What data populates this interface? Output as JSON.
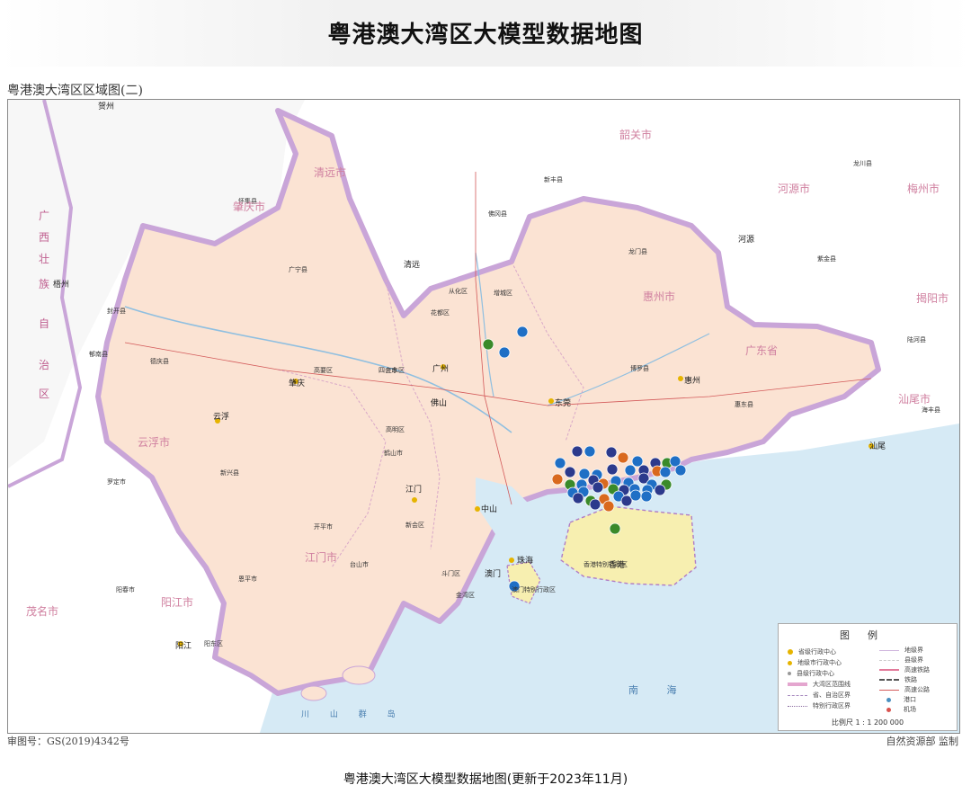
{
  "header": {
    "title": "粤港澳大湾区大模型数据地图"
  },
  "map": {
    "name": "粤港澳大湾区区域图(二)",
    "review_number": "审图号：GS(2019)4342号",
    "supervisor": "自然资源部 监制",
    "caption": "粤港澳大湾区大模型数据地图(更新于2023年11月)"
  },
  "legend": {
    "title": "图例",
    "items_left": [
      "省级行政中心",
      "地级市行政中心",
      "县级行政中心",
      "大湾区范围线",
      "省、自治区界",
      "特别行政区界"
    ],
    "items_right": [
      "地级界",
      "县级界",
      "高速铁路",
      "铁路",
      "高速公路",
      "港口",
      "机场"
    ],
    "scale": "比例尺 1 : 1 200 000"
  },
  "colors": {
    "blue": "#1f6fc5",
    "navy": "#2c3a8c",
    "green": "#3a8a2a",
    "orange": "#d9691e",
    "land": "#fbe3d3",
    "sea": "#d6eaf5",
    "outside": "#ffffff",
    "boundary": "#c9a5d8"
  },
  "markers": [
    {
      "color": "green"
    },
    {
      "color": "blue"
    },
    {
      "color": "blue"
    },
    {
      "color": "green"
    },
    {
      "color": "blue"
    },
    {
      "color": "blue"
    },
    {
      "color": "navy"
    },
    {
      "color": "blue"
    },
    {
      "color": "navy"
    },
    {
      "color": "orange"
    },
    {
      "color": "blue"
    },
    {
      "color": "navy"
    },
    {
      "color": "green"
    },
    {
      "color": "blue"
    },
    {
      "color": "navy"
    },
    {
      "color": "blue"
    },
    {
      "color": "blue"
    },
    {
      "color": "navy"
    },
    {
      "color": "blue"
    },
    {
      "color": "navy"
    },
    {
      "color": "orange"
    },
    {
      "color": "blue"
    },
    {
      "color": "blue"
    },
    {
      "color": "orange"
    },
    {
      "color": "green"
    },
    {
      "color": "blue"
    },
    {
      "color": "navy"
    },
    {
      "color": "orange"
    },
    {
      "color": "blue"
    },
    {
      "color": "blue"
    },
    {
      "color": "navy"
    },
    {
      "color": "blue"
    },
    {
      "color": "green"
    },
    {
      "color": "blue"
    },
    {
      "color": "blue"
    },
    {
      "color": "navy"
    },
    {
      "color": "green"
    },
    {
      "color": "navy"
    },
    {
      "color": "blue"
    },
    {
      "color": "blue"
    },
    {
      "color": "navy"
    },
    {
      "color": "navy"
    },
    {
      "color": "green"
    },
    {
      "color": "orange"
    },
    {
      "color": "blue"
    },
    {
      "color": "navy"
    },
    {
      "color": "blue"
    },
    {
      "color": "blue"
    },
    {
      "color": "navy"
    },
    {
      "color": "orange"
    }
  ],
  "places": {
    "guangzhou": "广州",
    "foshan": "佛山",
    "dongguan": "东莞",
    "huizhou": "惠州",
    "jiangmen": "江门",
    "zhongshan": "中山",
    "zhuhai": "珠海",
    "macau": "澳门",
    "hongkong": "香港",
    "zhaoqing": "肇庆",
    "yunfu": "云浮",
    "yangjiang": "阳江",
    "qingyuan": "清远",
    "heyuan": "河源",
    "shanwei": "汕尾",
    "wuzhou": "梧州",
    "hezhou": "贺州",
    "shaoguan": "韶关",
    "haifeng": "海丰县",
    "luhe": "陆河县",
    "huidong": "惠东县",
    "boluo": "博罗县",
    "zengcheng": "增城区",
    "conghua": "从化区",
    "huadu": "花都区",
    "sanshui": "三水区",
    "gaoming": "高明区",
    "heshan": "鹤山市",
    "taishan": "台山市",
    "kaiping": "开平市",
    "enping": "恩平市",
    "xinhui": "新会区",
    "doumen": "斗门区",
    "jinwan": "金湾区",
    "xinxing": "新兴县",
    "luoding": "罗定市",
    "yunan": "郁南县",
    "deqing": "德庆县",
    "fengkai": "封开县",
    "huaiji": "怀集县",
    "guangning": "广宁县",
    "sihui": "四会市",
    "gaoyao": "高要区",
    "yangchun": "阳春市",
    "longmen": "龙门县",
    "fogang": "佛冈县",
    "xinfeng": "新丰县",
    "zijin": "紫金县",
    "longchuan": "龙川县",
    "yangdong": "阳东区",
    "hk_sar": "香港特别行政区",
    "mo_sar": "澳门特别行政区",
    "prov_guangdong": "广东省",
    "gx_1": "广",
    "gx_2": "西",
    "gx_3": "壮",
    "gx_4": "族",
    "gx_5": "自",
    "gx_6": "治",
    "gx_7": "区",
    "pref_zhaoqing": "肇庆市",
    "pref_qingyuan": "清远市",
    "pref_shaoguan": "韶关市",
    "pref_heyuan": "河源市",
    "pref_huizhou": "惠州市",
    "pref_yunfu": "云浮市",
    "pref_jiangmen": "江门市",
    "pref_yangjiang": "阳江市",
    "pref_meizhou": "梅州市",
    "pref_shanwei": "汕尾市",
    "pref_maoming": "茂名市",
    "pref_jieyang": "揭阳市",
    "sea_south": "南 海",
    "islands": "川 山 群 岛"
  }
}
